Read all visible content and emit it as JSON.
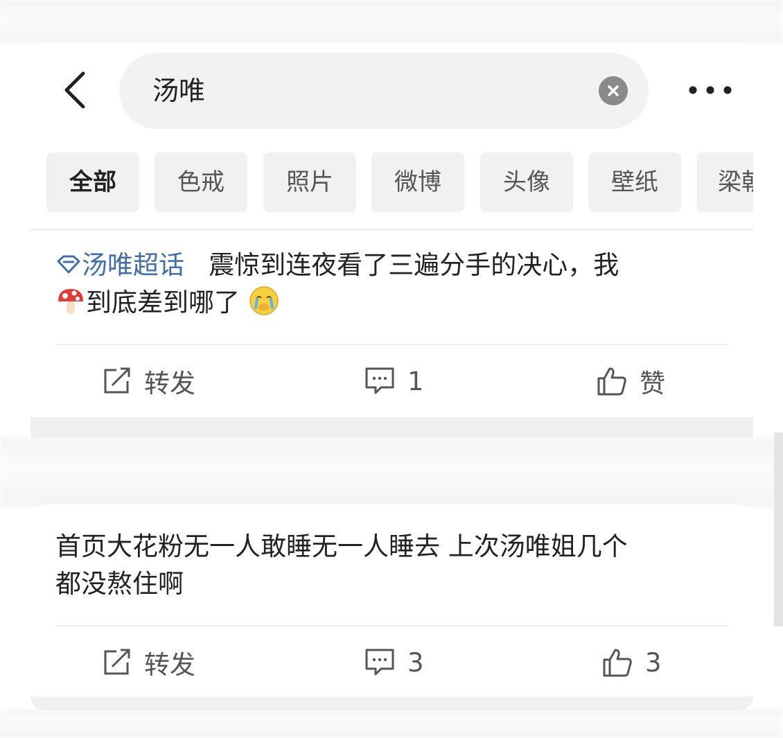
{
  "search": {
    "query": "汤唯"
  },
  "tabs": [
    "全部",
    "色戒",
    "照片",
    "微博",
    "头像",
    "壁纸",
    "梁朝"
  ],
  "posts": [
    {
      "topic": "汤唯超话",
      "text_line1": "震惊到连夜看了三遍分手的决心，我",
      "text_line2": "到底差到哪了",
      "repost_label": "转发",
      "comment_count": "1",
      "like_label": "赞"
    },
    {
      "text_line1": "首页大花粉无一人敢睡无一人睡去 上次汤唯姐几个",
      "text_line2": "都没熬住啊",
      "repost_label": "转发",
      "comment_count": "3",
      "like_label": "3"
    }
  ],
  "colors": {
    "topic": "#3f6fa6",
    "accent_bg": "#f1f1f1"
  },
  "icons": [
    "back-arrow-icon",
    "clear-icon",
    "more-icon",
    "super-topic-icon",
    "mushroom-emoji",
    "crying-emoji",
    "repost-icon",
    "comment-icon",
    "like-icon"
  ]
}
